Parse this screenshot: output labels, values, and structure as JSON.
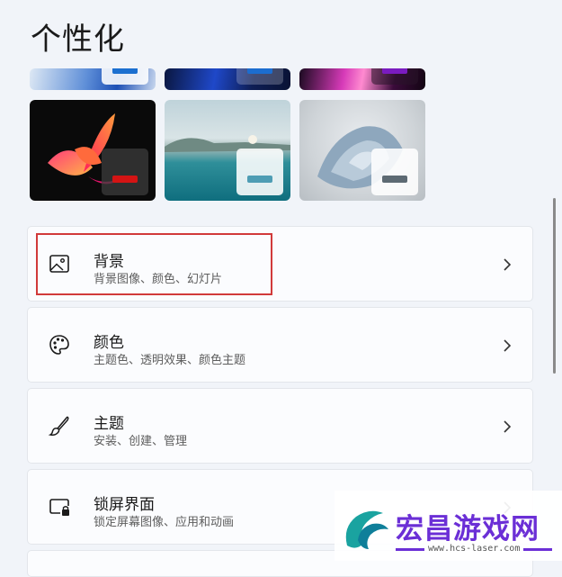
{
  "page": {
    "title": "个性化"
  },
  "themes": [
    {
      "name": "glow-blue",
      "accent": "#1b6fd0"
    },
    {
      "name": "bloom-blue",
      "accent": "#1c6dcf"
    },
    {
      "name": "glow-purple",
      "accent": "#7a1bbf"
    },
    {
      "name": "captured-motion",
      "accent": "#d41414"
    },
    {
      "name": "lake-sunrise",
      "accent": "#4e9db4"
    },
    {
      "name": "flow-gray",
      "accent": "#5d6a73"
    }
  ],
  "settings": [
    {
      "title": "背景",
      "subtitle": "背景图像、颜色、幻灯片",
      "icon": "image-icon"
    },
    {
      "title": "颜色",
      "subtitle": "主题色、透明效果、颜色主题",
      "icon": "palette-icon"
    },
    {
      "title": "主题",
      "subtitle": "安装、创建、管理",
      "icon": "brush-icon"
    },
    {
      "title": "锁屏界面",
      "subtitle": "锁定屏幕图像、应用和动画",
      "icon": "lock-screen-icon"
    }
  ],
  "watermark": {
    "name": "宏昌游戏网",
    "url": "www.hcs-laser.com"
  }
}
